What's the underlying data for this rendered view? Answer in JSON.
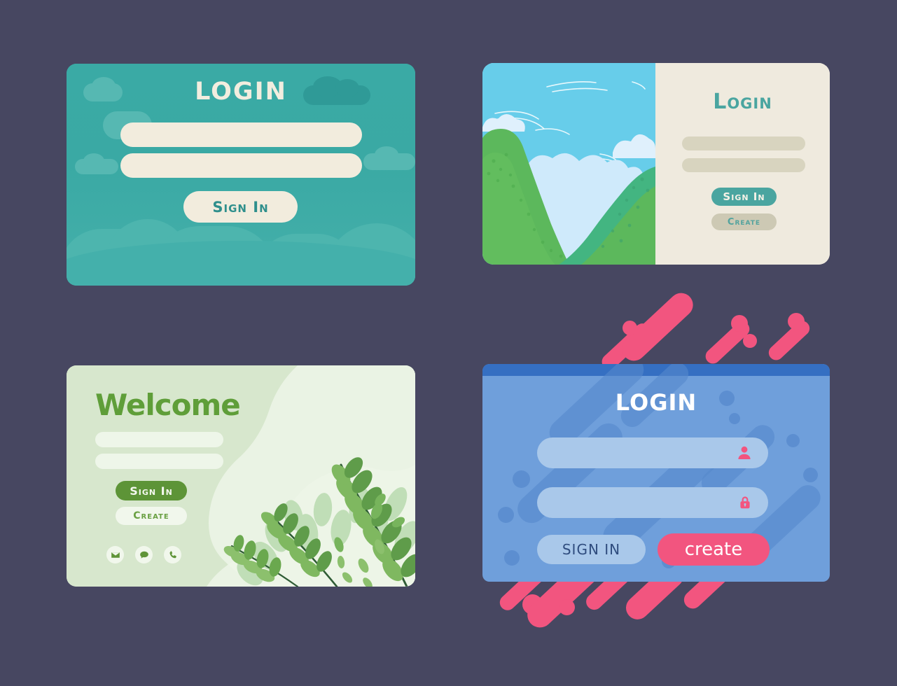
{
  "page": {
    "background_color": "#474761",
    "title": "Login Screen UI Card Set"
  },
  "cards": [
    {
      "id": "teal-sky-login",
      "title": "LOGIN",
      "theme_colors": {
        "background": "#38a9a4",
        "field": "#f2ecdd",
        "button_text": "#2f8f8c"
      },
      "fields": [
        {
          "name": "username",
          "value": "",
          "placeholder": ""
        },
        {
          "name": "password",
          "value": "",
          "placeholder": ""
        }
      ],
      "buttons": [
        {
          "name": "sign-in",
          "label": "Sign In"
        }
      ],
      "decor": [
        "cloud",
        "cloud",
        "cloud",
        "cloud",
        "hill"
      ]
    },
    {
      "id": "landscape-login",
      "title": "Login",
      "theme_colors": {
        "panel": "#efeade",
        "sky": "#67cdea",
        "hill_light": "#5cb85c",
        "hill_dark": "#43b581",
        "accent": "#4aa5a0",
        "field": "#d8d4bf"
      },
      "fields": [
        {
          "name": "username",
          "value": "",
          "placeholder": ""
        },
        {
          "name": "password",
          "value": "",
          "placeholder": ""
        }
      ],
      "buttons": [
        {
          "name": "sign-in",
          "label": "Sign In"
        },
        {
          "name": "create",
          "label": "Create"
        }
      ],
      "decor": [
        "sky",
        "clouds",
        "wind-lines",
        "green-hills"
      ]
    },
    {
      "id": "welcome-leaves",
      "title": "Welcome",
      "theme_colors": {
        "background": "#d7e7cd",
        "title": "#5f9e39",
        "field": "#eef6e9",
        "primary_button": "#5d9437",
        "secondary_button": "#f1f7ec"
      },
      "fields": [
        {
          "name": "username",
          "value": "",
          "placeholder": ""
        },
        {
          "name": "password",
          "value": "",
          "placeholder": ""
        }
      ],
      "buttons": [
        {
          "name": "sign-in",
          "label": "Sign In"
        },
        {
          "name": "create",
          "label": "Create"
        }
      ],
      "social_icons": [
        {
          "name": "mail-icon",
          "label": "mail"
        },
        {
          "name": "chat-icon",
          "label": "chat"
        },
        {
          "name": "phone-icon",
          "label": "phone"
        }
      ],
      "decor": [
        "blob",
        "fern-leaves",
        "floating-leaves"
      ]
    },
    {
      "id": "blue-login",
      "title": "LOGIN",
      "theme_colors": {
        "background": "#6f9fdb",
        "topbar": "#356fc2",
        "field": "#a9c8ea",
        "accent_pink": "#f2557f",
        "sign_in_text": "#2f4c7e"
      },
      "fields": [
        {
          "name": "username",
          "value": "",
          "placeholder": "",
          "icon": "user-icon"
        },
        {
          "name": "password",
          "value": "",
          "placeholder": "",
          "icon": "lock-icon"
        }
      ],
      "buttons": [
        {
          "name": "sign-in",
          "label": "SIGN IN"
        },
        {
          "name": "create",
          "label": "create"
        }
      ],
      "decor": [
        "pink-diagonal-bars",
        "pink-dots",
        "blue-dots",
        "blue-diagonal-bars"
      ]
    }
  ]
}
